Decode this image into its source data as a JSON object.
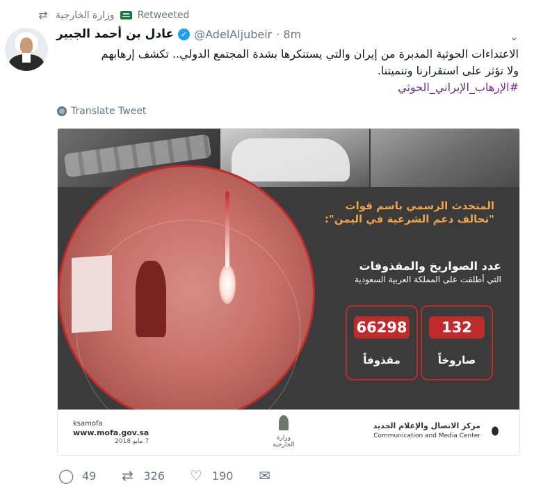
{
  "retweet_context": {
    "account": "وزارة الخارجية",
    "label": "Retweeted",
    "icon": "retweet-icon"
  },
  "author": {
    "name": "عادل بن أحمد الجبير",
    "handle": "@AdelAljubeir",
    "time": "· 8m",
    "verified_icon": "verified-badge-icon"
  },
  "tweet": {
    "text_line1": "الاعتداءات الحوثية المدبرة من إيران والتي يستنكرها بشدة المجتمع الدولي.. تكشف إرهابهم",
    "text_line2": "ولا تؤثر على استقرارنا وتنميتنا.",
    "hashtag": "#الإرهاب_الإيراني_الحوثي",
    "translate_label": "Translate Tweet"
  },
  "media": {
    "title_line1": "المتحدث الرسمي باسم قوات",
    "title_line2": "\"تحالف دعم الشرعية في اليمن\":",
    "count_title": "عدد الصواريخ والمقذوفات",
    "count_sub": "التي أطلقت على المملكة العربية السعودية",
    "stats": [
      {
        "value": "66298",
        "label": "مقذوفاً"
      },
      {
        "value": "132",
        "label": "صاروخاً"
      }
    ],
    "footer": {
      "social": "ksamofa",
      "website": "www.mofa.gov.sa",
      "date": "7 مايو 2018",
      "emblem_text": "وزارة الخارجية",
      "center_ar": "مركز الاتصال والإعلام الجديد",
      "center_en": "Communication and Media Center"
    }
  },
  "actions": {
    "reply": {
      "icon": "reply-icon",
      "count": "49"
    },
    "retweet": {
      "icon": "retweet-icon",
      "count": "326"
    },
    "like": {
      "icon": "heart-icon",
      "count": "190"
    },
    "message": {
      "icon": "envelope-icon"
    }
  },
  "colors": {
    "link_blue": "#1da1f2",
    "hashtag_purple": "#6f2c91",
    "accent_red": "#c02a2a",
    "accent_orange": "#f0a54a",
    "muted": "#657786"
  }
}
